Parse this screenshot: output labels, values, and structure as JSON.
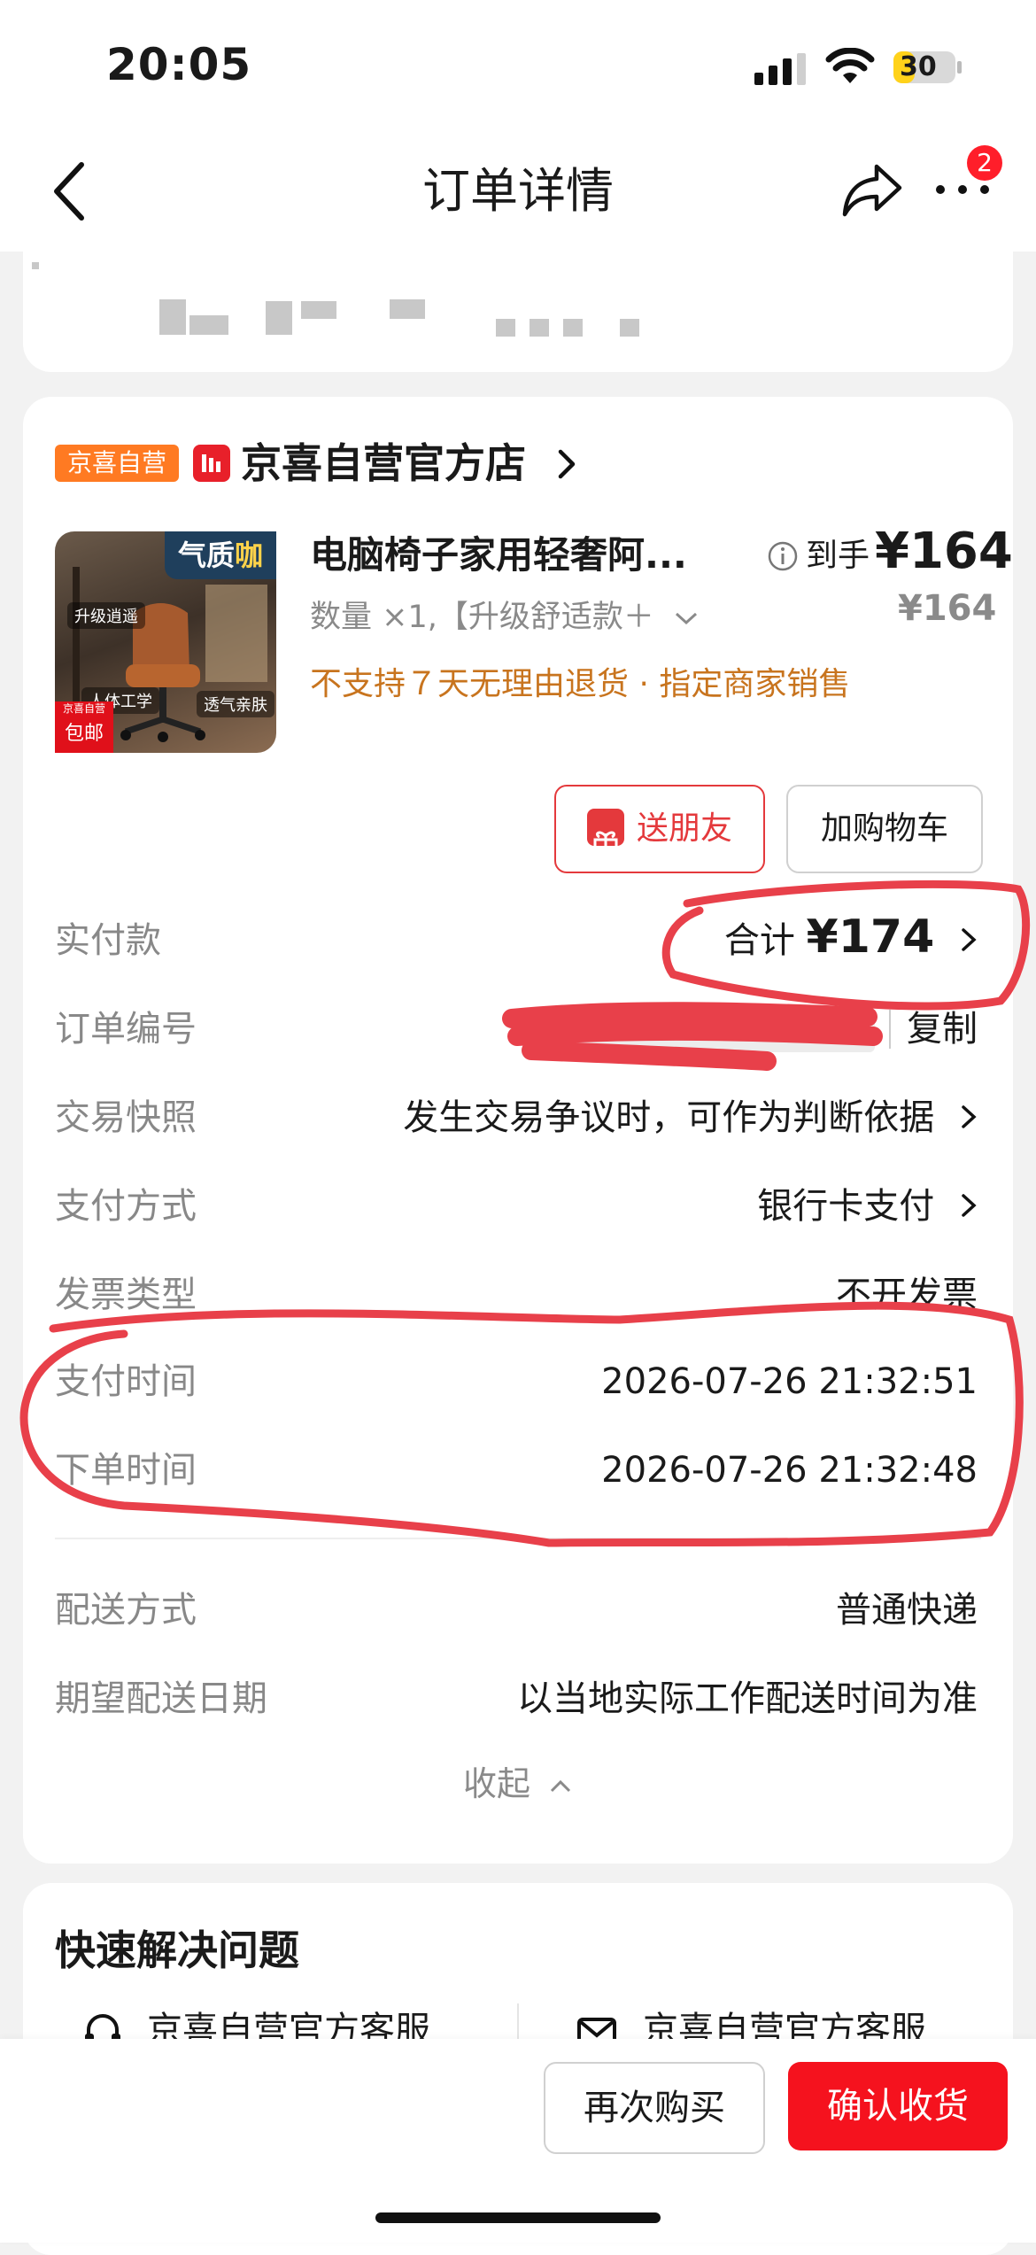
{
  "status_bar": {
    "time": "20:05",
    "battery": "30"
  },
  "nav": {
    "title": "订单详情",
    "badge_count": "2"
  },
  "store": {
    "tag": "京喜自营",
    "name": "京喜自营官方店"
  },
  "product": {
    "image_label_prefix": "气质",
    "image_label_highlight": "咖",
    "image_chips": [
      "升级逍遥",
      "人体工学",
      "透气亲肤"
    ],
    "image_promo_top": "京喜自营",
    "image_promo": "包邮",
    "title": "电脑椅子家用轻奢阿...",
    "spec": "数量 ×1,【升级舒适款＋",
    "note": "不支持７天无理由退货 · 指定商家销售",
    "price_label": "到手",
    "price": "¥164",
    "original_price": "¥164"
  },
  "actions": {
    "gift": "送朋友",
    "cart": "加购物车"
  },
  "details": {
    "paid_label": "实付款",
    "total_prefix": "合计",
    "total": "¥174",
    "order_no_label": "订单编号",
    "copy": "复制",
    "snapshot_label": "交易快照",
    "snapshot_value": "发生交易争议时，可作为判断依据",
    "pay_method_label": "支付方式",
    "pay_method_value": "银行卡支付",
    "invoice_label": "发票类型",
    "invoice_value": "不开发票",
    "pay_time_label": "支付时间",
    "pay_time_value": "2026-07-26 21:32:51",
    "order_time_label": "下单时间",
    "order_time_value": "2026-07-26 21:32:48",
    "delivery_label": "配送方式",
    "delivery_value": "普通快递",
    "expected_label": "期望配送日期",
    "expected_value": "以当地实际工作配送时间为准",
    "collapse": "收起"
  },
  "quick_solve": {
    "title": "快速解决问题",
    "items": [
      "京喜自营官方客服",
      "京喜自营官方客服"
    ]
  },
  "bottom": {
    "rebuy": "再次购买",
    "confirm": "确认收货"
  },
  "colors": {
    "accent": "#f5121e",
    "store_tag": "#ff7a22",
    "warning_text": "#c8741e",
    "annotation": "#e8404a"
  }
}
